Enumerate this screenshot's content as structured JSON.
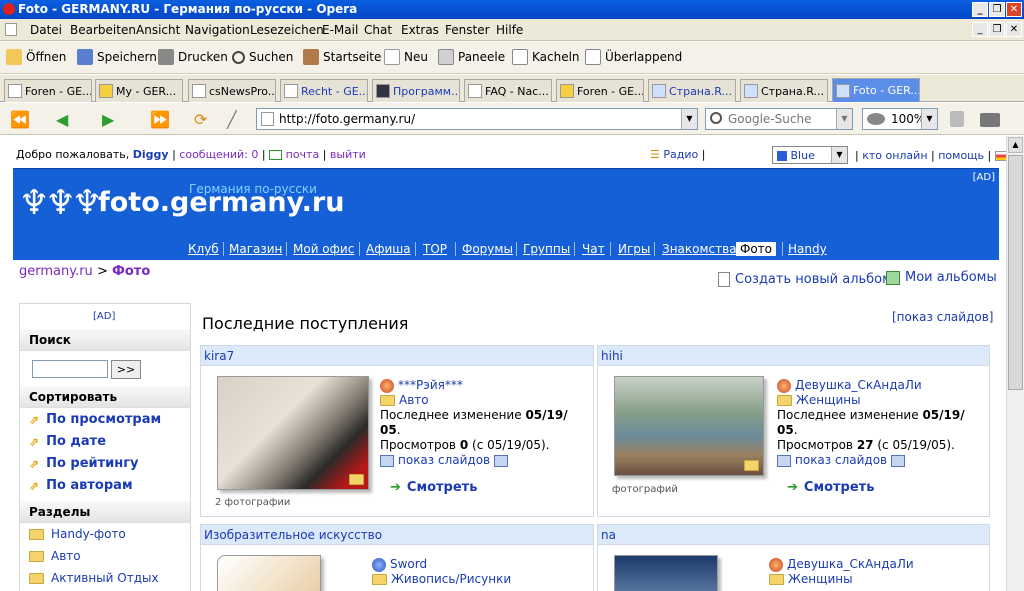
{
  "window": {
    "title": "Foto - GERMANY.RU - Германия по-русски - Opera"
  },
  "menu": [
    "Datei",
    "Bearbeiten",
    "Ansicht",
    "Navigation",
    "Lesezeichen",
    "E-Mail",
    "Chat",
    "Extras",
    "Fenster",
    "Hilfe"
  ],
  "toolbar": {
    "open": "Öffnen",
    "save": "Speichern",
    "print": "Drucken",
    "search": "Suchen",
    "home": "Startseite",
    "new": "Neu",
    "panels": "Paneele",
    "tile": "Kacheln",
    "cascade": "Überlappend"
  },
  "tabs": [
    "Foren - GE...",
    "My - GER...",
    "csNewsPro...",
    "Recht - GE...",
    "Программ...",
    "FAQ - Nac...",
    "Foren - GE...",
    "Страна.R...",
    "Страна.R...",
    "Foto - GER..."
  ],
  "address": {
    "url": "http://foto.germany.ru/",
    "search_placeholder": "Google-Suche",
    "zoom": "100%"
  },
  "site": {
    "welcome": "Добро пожаловать,",
    "username": "Diggy",
    "messages": "сообщений: 0",
    "mail": "почта",
    "logout": "выйти",
    "radio": "Радио",
    "theme": "Blue",
    "online": "кто онлайн",
    "help": "помощь",
    "ad": "[AD]",
    "logo_main": "foto.germany.ru",
    "logo_tagline": "Германия по-русски",
    "nav": [
      "Клуб",
      "Магазин",
      "Мой офис",
      "Афиша",
      "TOP",
      "Форумы",
      "Группы",
      "Чат",
      "Игры",
      "Знакомства",
      "Фото",
      "Handy"
    ],
    "breadcrumb_root": "germany.ru",
    "breadcrumb_sep": ">",
    "breadcrumb_current": "Фото",
    "create_album": "Создать новый альбом",
    "my_albums": "Мои альбомы"
  },
  "sidebar": {
    "ad": "[AD]",
    "search_title": "Поиск",
    "search_button": ">>",
    "sort_title": "Сортировать",
    "sort_items": [
      "По просмотрам",
      "По дате",
      "По рейтингу",
      "По авторам"
    ],
    "sections_title": "Разделы",
    "sections": [
      "Handy-фото",
      "Авто",
      "Активный Отдых"
    ]
  },
  "main": {
    "title": "Последние поступления",
    "slideshow_link": "[показ слайдов]",
    "albums": [
      {
        "name": "kira7",
        "author": "***Рэйя***",
        "category": "Авто",
        "modified_label": "Последнее изменение",
        "modified_date": "05/19/",
        "modified_date2": "05",
        "views_label": "Просмотров",
        "views": "0",
        "views_since": "(с 05/19/05).",
        "slideshow": "показ слайдов",
        "view": "Смотреть",
        "photo_count": "2 фотографии"
      },
      {
        "name": "hihi",
        "author": "Девушка_СкАндаЛи",
        "category": "Женщины",
        "modified_label": "Последнее изменение",
        "modified_date": "05/19/",
        "modified_date2": "05",
        "views_label": "Просмотров",
        "views": "27",
        "views_since": "(с 05/19/05).",
        "slideshow": "показ слайдов",
        "view": "Смотреть",
        "photo_count": "фотографий"
      },
      {
        "name": "Изобразительное искусство",
        "author": "Sword",
        "category": "Живопись/Рисунки"
      },
      {
        "name": "na",
        "author": "Девушка_СкАндаЛи",
        "category": "Женщины"
      }
    ]
  },
  "colors": {
    "banner": "#1560d6",
    "link": "#1a3bb3",
    "card_header": "#dbe9fb"
  }
}
